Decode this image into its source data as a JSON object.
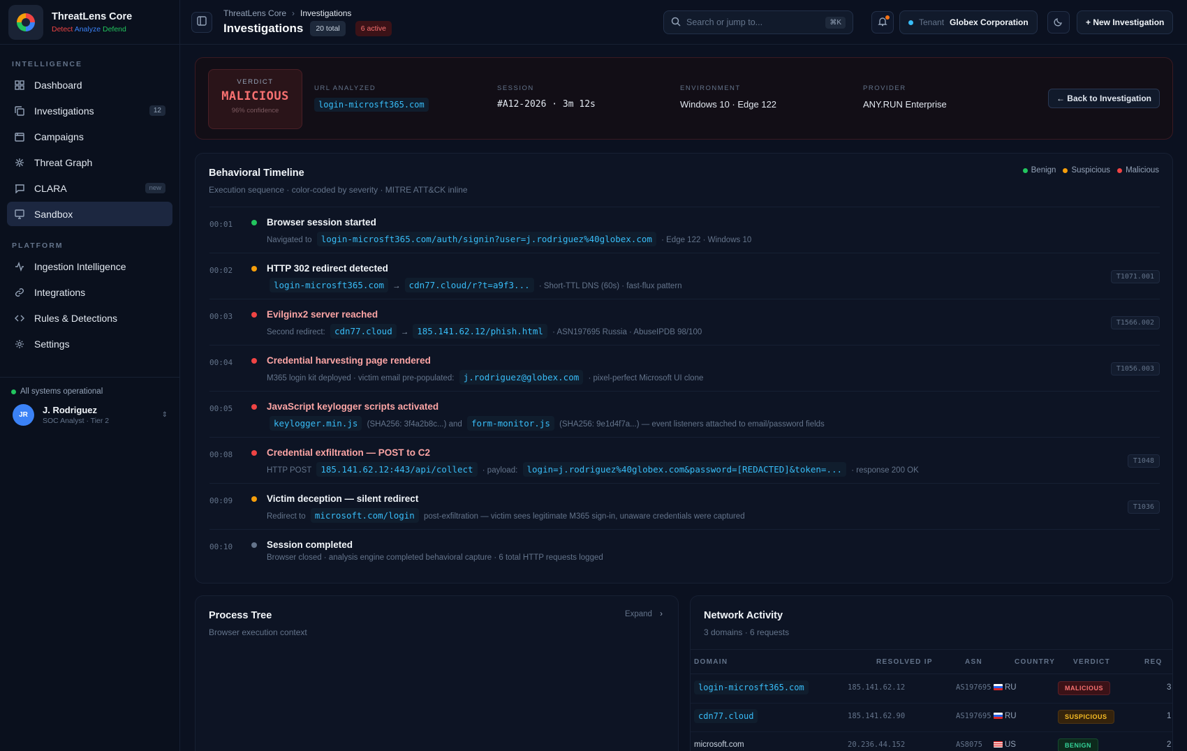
{
  "brand": {
    "name": "ThreatLens Core",
    "tag1": "Detect",
    "tag2": "Analyze",
    "tag3": "Defend"
  },
  "sidebar": {
    "section_intel": "INTELLIGENCE",
    "section_platform": "PLATFORM",
    "items": [
      {
        "label": "Dashboard",
        "icon": "grid-icon"
      },
      {
        "label": "Investigations",
        "icon": "copy-icon",
        "badge": "12"
      },
      {
        "label": "Campaigns",
        "icon": "calendar-icon"
      },
      {
        "label": "Threat Graph",
        "icon": "graph-icon"
      },
      {
        "label": "CLARA",
        "icon": "chat-icon",
        "badge": "new"
      },
      {
        "label": "Sandbox",
        "icon": "monitor-icon",
        "active": true
      },
      {
        "label": "Ingestion Intelligence",
        "icon": "activity-icon"
      },
      {
        "label": "Integrations",
        "icon": "link-icon"
      },
      {
        "label": "Rules & Detections",
        "icon": "code-icon"
      },
      {
        "label": "Settings",
        "icon": "gear-icon"
      }
    ],
    "status": "All systems operational",
    "user": {
      "initials": "JR",
      "name": "J. Rodriguez",
      "role": "SOC Analyst · Tier 2"
    }
  },
  "header": {
    "breadcrumb_root": "ThreatLens Core",
    "breadcrumb_current": "Investigations",
    "title": "Investigations",
    "total_pill": "20 total",
    "active_pill": "6 active",
    "search_placeholder": "Search or jump to...",
    "search_shortcut": "⌘K",
    "tenant_label": "Tenant",
    "tenant_name": "Globex Corporation",
    "new_button": "+ New Investigation"
  },
  "verdict": {
    "label": "VERDICT",
    "value": "MALICIOUS",
    "confidence": "96% confidence",
    "fields": [
      {
        "label": "URL ANALYZED",
        "value": "login-microsft365.com"
      },
      {
        "label": "SESSION",
        "value": "#A12-2026 · 3m 12s"
      },
      {
        "label": "ENVIRONMENT",
        "value": "Windows 10 · Edge 122"
      },
      {
        "label": "PROVIDER",
        "value": "ANY.RUN Enterprise"
      }
    ],
    "back_button": "← Back to Investigation"
  },
  "timeline": {
    "title": "Behavioral Timeline",
    "subtitle": "Execution sequence · color-coded by severity · MITRE ATT&CK inline",
    "legend": [
      "Benign",
      "Suspicious",
      "Malicious"
    ],
    "colors": {
      "benign": "#22c55e",
      "suspicious": "#f59e0b",
      "malicious": "#ef4444",
      "neutral": "#64748b"
    },
    "events": [
      {
        "time": "00:01",
        "severity": "benign",
        "title": "Browser session started",
        "d1": "Navigated to",
        "c1": "login-microsft365.com/auth/signin?user=j.rodriguez%40globex.com",
        "d2": "· Edge 122 · Windows 10"
      },
      {
        "time": "00:02",
        "severity": "suspicious",
        "title": "HTTP 302 redirect detected",
        "tag": "T1071.001",
        "c1": "login-microsft365.com",
        "c2": "cdn77.cloud/r?t=a9f3...",
        "d2": "· Short-TTL DNS (60s) · fast-flux pattern"
      },
      {
        "time": "00:03",
        "severity": "malicious",
        "title": "Evilginx2 server reached",
        "tag": "T1566.002",
        "d1": "Second redirect:",
        "c1": "cdn77.cloud",
        "c2": "185.141.62.12/phish.html",
        "d2": "· ASN197695 Russia · AbuseIPDB 98/100"
      },
      {
        "time": "00:04",
        "severity": "malicious",
        "title": "Credential harvesting page rendered",
        "tag": "T1056.003",
        "d1": "M365 login kit deployed · victim email pre-populated:",
        "c1": "j.rodriguez@globex.com",
        "d2": "· pixel-perfect Microsoft UI clone"
      },
      {
        "time": "00:05",
        "severity": "malicious",
        "title": "JavaScript keylogger scripts activated",
        "c1": "keylogger.min.js",
        "d1": "(SHA256: 3f4a2b8c...) and",
        "c2": "form-monitor.js",
        "d2": "(SHA256: 9e1d4f7a...) — event listeners attached to email/password fields"
      },
      {
        "time": "00:08",
        "severity": "malicious",
        "title": "Credential exfiltration — POST to C2",
        "tag": "T1048",
        "d0": "HTTP POST",
        "c1": "185.141.62.12:443/api/collect",
        "d1": "· payload:",
        "c2": "login=j.rodriguez%40globex.com&password=[REDACTED]&token=...",
        "d2": "· response 200 OK"
      },
      {
        "time": "00:09",
        "severity": "suspicious",
        "title": "Victim deception — silent redirect",
        "tag": "T1036",
        "d1": "Redirect to",
        "c1": "microsoft.com/login",
        "d2": "post-exfiltration — victim sees legitimate M365 sign-in, unaware credentials were captured"
      },
      {
        "time": "00:10",
        "severity": "neutral",
        "title": "Session completed",
        "d1": "Browser closed · analysis engine completed behavioral capture · 6 total HTTP requests logged"
      }
    ]
  },
  "process_tree": {
    "title": "Process Tree",
    "subtitle": "Browser execution context",
    "expand": "Expand"
  },
  "network": {
    "title": "Network Activity",
    "subtitle": "3 domains · 6 requests",
    "columns": [
      "DOMAIN",
      "RESOLVED IP",
      "ASN",
      "COUNTRY",
      "VERDICT",
      "REQ"
    ],
    "rows": [
      {
        "domain": "login-microsft365.com",
        "ip": "185.141.62.12",
        "asn": "AS197695",
        "country": "RU",
        "verdict": "MALICIOUS",
        "req": "3"
      },
      {
        "domain": "cdn77.cloud",
        "ip": "185.141.62.90",
        "asn": "AS197695",
        "country": "RU",
        "verdict": "SUSPICIOUS",
        "req": "1"
      },
      {
        "domain": "microsoft.com",
        "ip": "20.236.44.152",
        "asn": "AS8075",
        "country": "US",
        "verdict": "BENIGN",
        "req": "2"
      }
    ]
  }
}
